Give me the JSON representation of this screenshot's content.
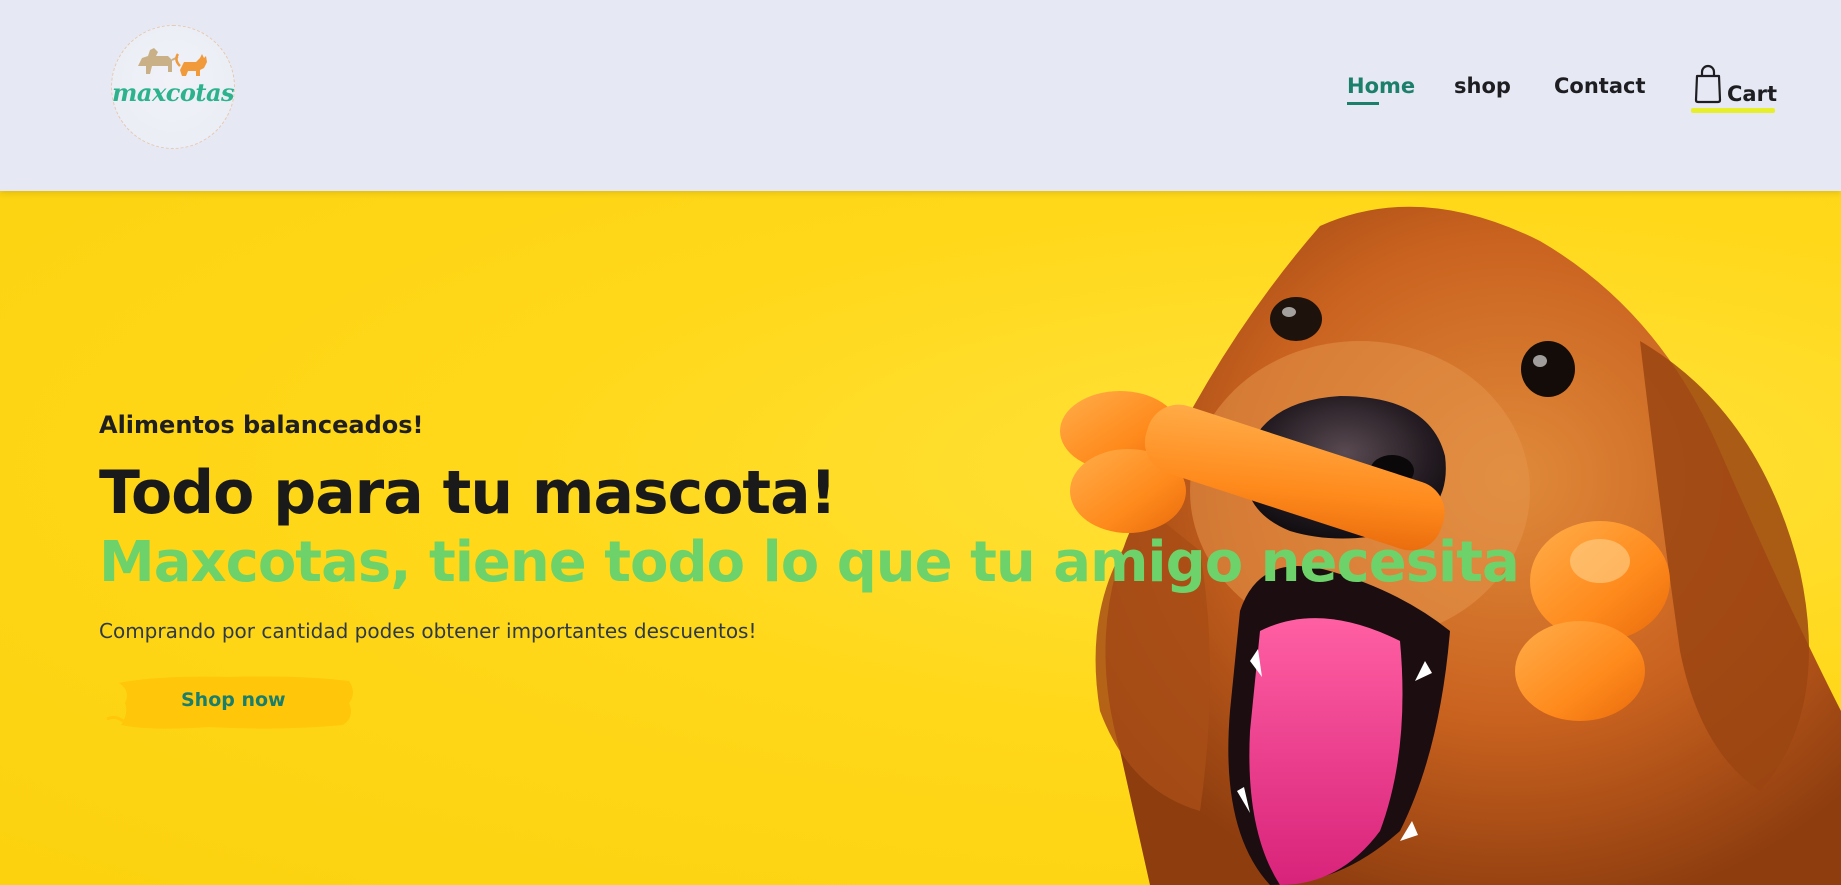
{
  "header": {
    "logo": {
      "text": "maxcotas",
      "icon": "dog-and-cat-logo-icon",
      "text_color": "#2cb38e"
    },
    "nav": {
      "home_label": "Home",
      "shop_label": "shop",
      "contact_label": "Contact",
      "cart_label": "Cart",
      "cart_icon": "shopping-bag-icon",
      "active_item": "Home",
      "active_color": "#1c7f6c",
      "cart_highlight_color": "#e7ef2d"
    },
    "background_color": "#e6e9f4"
  },
  "hero": {
    "kicker": "Alimentos balanceados!",
    "title": "Todo para tu mascota!",
    "subtitle": "Maxcotas, tiene todo lo que tu amigo necesita",
    "description": "Comprando por cantidad podes obtener importantes descuentos!",
    "cta_label": "Shop now",
    "background_color": "#ffd81a",
    "subtitle_color": "#6ed26a",
    "cta_color": "#197e6c",
    "image": "golden-retriever-with-orange-bone-toy"
  }
}
